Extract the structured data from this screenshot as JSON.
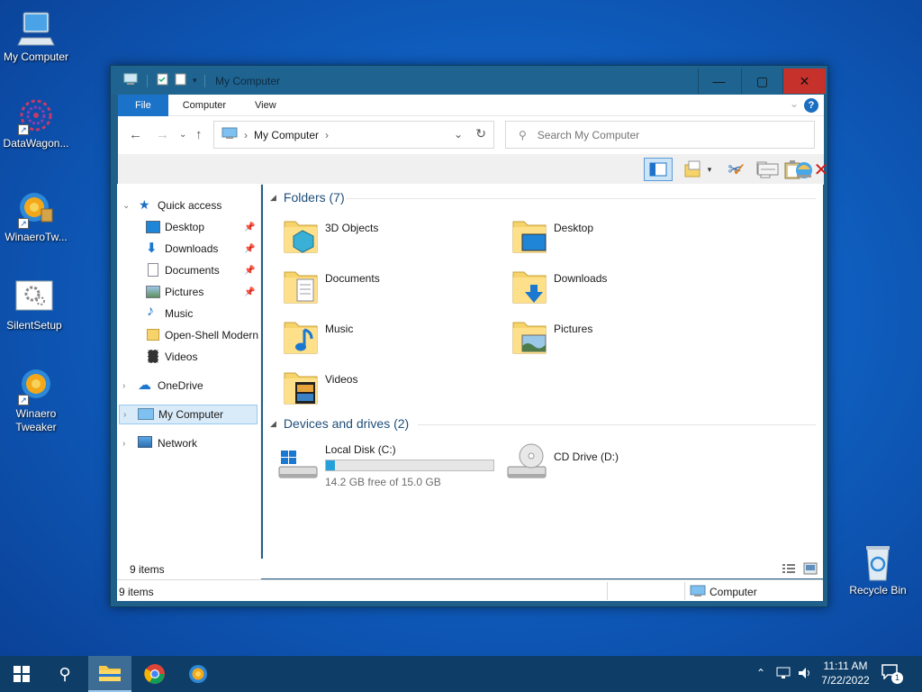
{
  "desktop": {
    "icons": [
      {
        "label": "My Computer"
      },
      {
        "label": "DataWagon..."
      },
      {
        "label": "WinaeroTw..."
      },
      {
        "label": "SilentSetup"
      },
      {
        "label": "Winaero\nTweaker"
      },
      {
        "label": "Recycle Bin"
      }
    ]
  },
  "window": {
    "title": "My Computer",
    "buttons": {
      "minimize": "—",
      "maximize": "▢",
      "close": "✕"
    },
    "ribbon": {
      "tabs": [
        "File",
        "Computer",
        "View"
      ],
      "help": "?"
    },
    "address": {
      "crumb": "My Computer",
      "separator": "›"
    },
    "search": {
      "placeholder": "Search My Computer"
    },
    "sidebar": {
      "quick_access": "Quick access",
      "items": [
        {
          "label": "Desktop",
          "pinned": true
        },
        {
          "label": "Downloads",
          "pinned": true
        },
        {
          "label": "Documents",
          "pinned": true
        },
        {
          "label": "Pictures",
          "pinned": true
        },
        {
          "label": "Music",
          "pinned": false
        },
        {
          "label": "Open-Shell Modern",
          "pinned": false
        },
        {
          "label": "Videos",
          "pinned": false
        }
      ],
      "onedrive": "OneDrive",
      "my_computer": "My Computer",
      "network": "Network"
    },
    "content": {
      "folders_header": "Folders (7)",
      "folders": [
        {
          "name": "3D Objects"
        },
        {
          "name": "Desktop"
        },
        {
          "name": "Documents"
        },
        {
          "name": "Downloads"
        },
        {
          "name": "Music"
        },
        {
          "name": "Pictures"
        },
        {
          "name": "Videos"
        }
      ],
      "devices_header": "Devices and drives (2)",
      "drives": [
        {
          "name": "Local Disk (C:)",
          "free_text": "14.2 GB free of 15.0 GB",
          "used_fraction": 0.053
        },
        {
          "name": "CD Drive (D:)"
        }
      ]
    },
    "status": {
      "items_count": "9 items",
      "bottom_count": "9 items",
      "location": "Computer"
    }
  },
  "taskbar": {
    "time": "11:11 AM",
    "date": "7/22/2022",
    "notification_count": "1"
  },
  "colors": {
    "accent": "#1a73c8",
    "close": "#c6312b",
    "taskbar": "#0e3e68",
    "progress": "#26a0da"
  }
}
